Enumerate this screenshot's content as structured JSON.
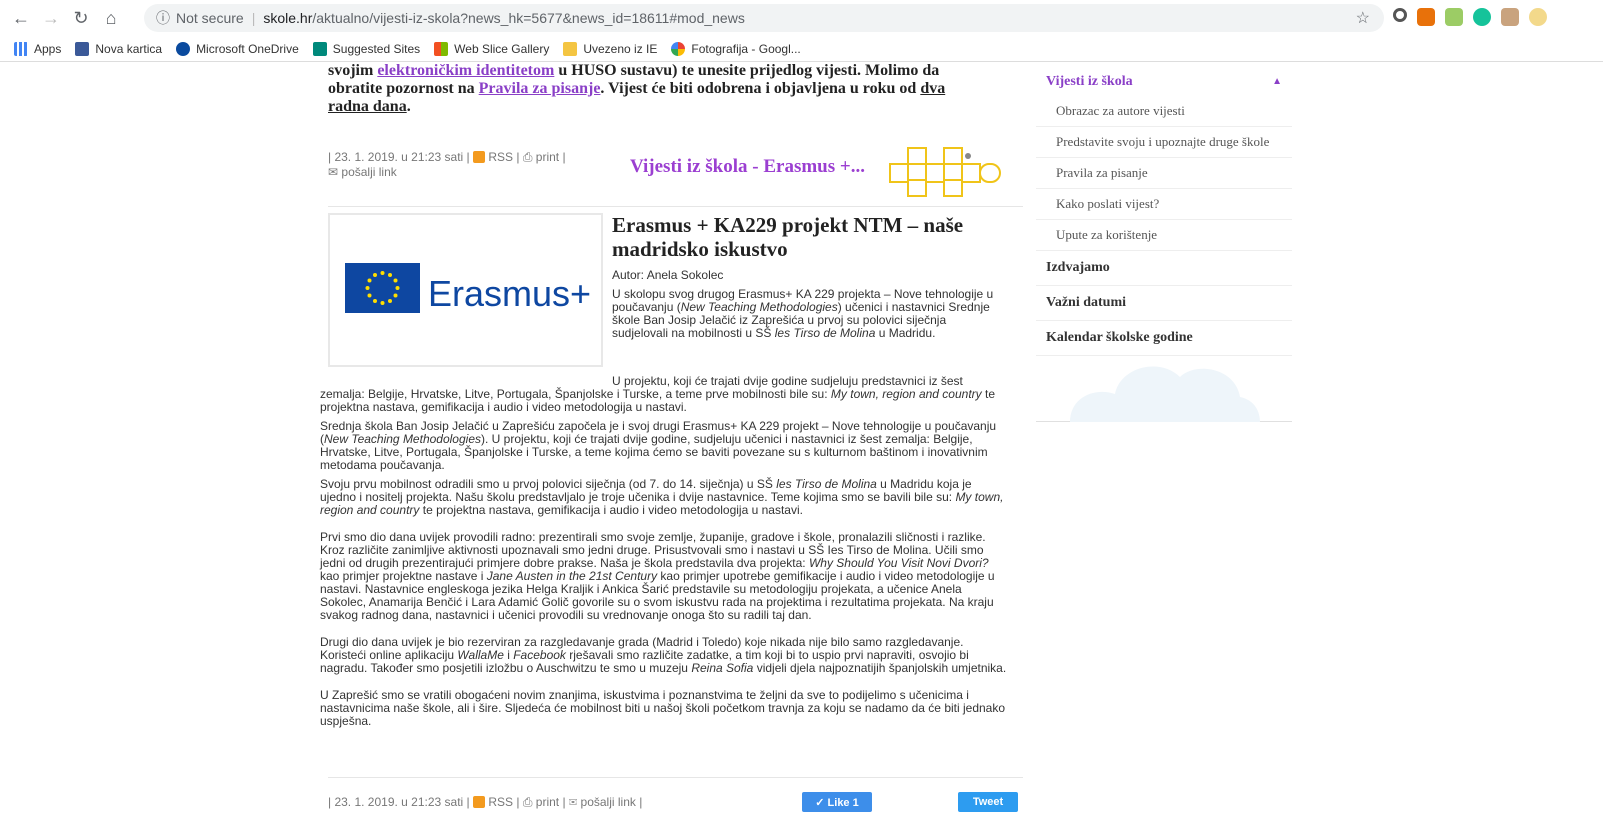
{
  "browser": {
    "security": "Not secure",
    "url_host": "skole.hr",
    "url_path": "/aktualno/vijesti-iz-skola?news_hk=5677&news_id=18611#mod_news",
    "bookmarks": [
      "Apps",
      "Nova kartica",
      "Microsoft OneDrive",
      "Suggested Sites",
      "Web Slice Gallery",
      "Uvezeno iz IE",
      "Fotografija - Googl..."
    ]
  },
  "intro": {
    "t1": "svojim ",
    "link1": "elektroničkim identitetom",
    "t2": " u HUSO sustavu) te unesite prijedlog vijesti. Molimo da obratite pozornost na ",
    "link2": "Pravila za pisanje",
    "t3": ". Vijest će biti odobrena i objavljena u roku od ",
    "link3": "dva radna dana",
    "t4": "."
  },
  "meta_top": {
    "date": "| 23. 1. 2019. u 21:23 sati |",
    "rss": "RSS",
    "print": "| ⎙ print |",
    "send": "✉ pošalji link"
  },
  "promo_title": "Vijesti iz škola - Erasmus +...",
  "article": {
    "logo_text": "Erasmus+",
    "title": "Erasmus + KA229 projekt NTM – naše madridsko iskustvo",
    "author_label": "Autor:",
    "author_name": "Anela Sokolec",
    "lead_a": "U skolopu svog drugog Erasmus+ KA 229 projekta – Nove tehnologije u poučavanju (",
    "lead_i": "New Teaching Methodologies",
    "lead_b": ") učenici i nastavnici Srednje škole Ban Josip Jelačić iz Zaprešića u prvoj su polovici siječnja sudjelovali  na mobilnosti u SŠ ",
    "lead_i2": "les Tirso de Molina",
    "lead_c": " u Madridu.",
    "p1_a": "U projektu, koji će trajati dvije godine sudjeluju predstavnici iz šest zemalja: Belgije, Hrvatske, Litve, Portugala, Španjolske i Turske, a teme prve mobilnosti bile su: ",
    "p1_i": "My town, region and country",
    "p1_b": " te projektna nastava, gemifikacija i audio i video metodologija u nastavi.",
    "p2_a": "Srednja škola Ban Josip Jelačić u Zaprešiću započela je i svoj drugi Erasmus+ KA 229 projekt – Nove tehnologije u poučavanju (",
    "p2_i": "New Teaching Methodologies",
    "p2_b": "). U projektu, koji će trajati dvije godine, sudjeluju učenici i nastavnici iz šest zemalja: Belgije, Hrvatske, Litve, Portugala, Španjolske i Turske, a teme kojima ćemo se baviti povezane su s kulturnom baštinom i inovativnim metodama poučavanja.",
    "p3_a": "Svoju prvu mobilnost odradili smo u prvoj polovici siječnja (od 7. do 14. siječnja) u SŠ ",
    "p3_i": "les Tirso de Molina",
    "p3_b": " u Madridu koja je ujedno i nositelj projekta. Našu školu predstavljalo je troje učenika i dvije nastavnice. Teme kojima smo se bavili bile su: ",
    "p3_i2": "My town, region and country",
    "p3_c": " te projektna nastava, gemifikacija i audio i video metodologija u nastavi.",
    "p4_a": "Prvi smo dio dana uvijek provodili radno: prezentirali smo svoje zemlje, županije, gradove i škole, pronalazili sličnosti i razlike. Kroz različite zanimljive aktivnosti upoznavali smo jedni druge. Prisustvovali smo i nastavi u SŠ Ies Tirso de Molina. Učili smo jedni od drugih prezentirajući primjere dobre prakse. Naša je škola predstavila dva projekta: ",
    "p4_i": "Why Should You Visit Novi Dvori?",
    "p4_b": " kao primjer projektne nastave i ",
    "p4_i2": "Jane Austen in the 21st Century",
    "p4_c": " kao primjer upotrebe gemifikacije i audio i video metodologije u nastavi. Nastavnice engleskoga jezika Helga Kraljik i Ankica Šarić predstavile su metodologiju projekata, a učenice Anela Sokolec, Anamarija Benčić i Lara Adamić Golič govorile su o svom iskustvu rada na projektima i rezultatima projekata. Na kraju svakog radnog dana, nastavnici i učenici provodili su vrednovanje onoga što su radili taj dan.",
    "p5_a": "Drugi dio dana uvijek je bio rezerviran za razgledavanje grada (Madrid i Toledo) koje nikada nije bilo samo razgledavanje. Koristeći online aplikaciju ",
    "p5_i": "WallaMe",
    "p5_b": " i ",
    "p5_i2": "Facebook",
    "p5_c": " rješavali smo različite zadatke, a tim koji bi to uspio prvi napraviti, osvojio bi nagradu. Također smo posjetili izložbu o Auschwitzu te smo u muzeju ",
    "p5_i3": "Reina Sofia",
    "p5_d": " vidjeli djela najpoznatijih španjolskih umjetnika.",
    "p6": "U Zaprešić smo se vratili obogaćeni novim znanjima, iskustvima i poznanstvima te željni da sve to podijelimo s učenicima i nastavnicima naše škole, ali i šire. Sljedeća će mobilnost biti u našoj školi početkom travnja za koju se nadamo da će biti jednako uspješna."
  },
  "meta_bottom": {
    "date": "| 23. 1. 2019. u 21:23 sati |",
    "rss": "RSS",
    "print": "| ⎙ print |",
    "send": "✉ pošalji link |"
  },
  "buttons": {
    "like": "✓ Like 1",
    "tweet": "Tweet"
  },
  "sidebar": {
    "header": "Vijesti iz škola",
    "sub": [
      "Obrazac za autore vijesti",
      "Predstavite svoju i upoznajte druge škole",
      "Pravila za pisanje",
      "Kako poslati vijest?",
      "Upute za korištenje"
    ],
    "main": [
      "Izdvajamo",
      "Važni datumi",
      "Kalendar školske godine"
    ]
  },
  "colors": {
    "accent": "#8a3fc7",
    "erasmus_blue": "#0e47a1",
    "rss": "#f39a1e"
  }
}
